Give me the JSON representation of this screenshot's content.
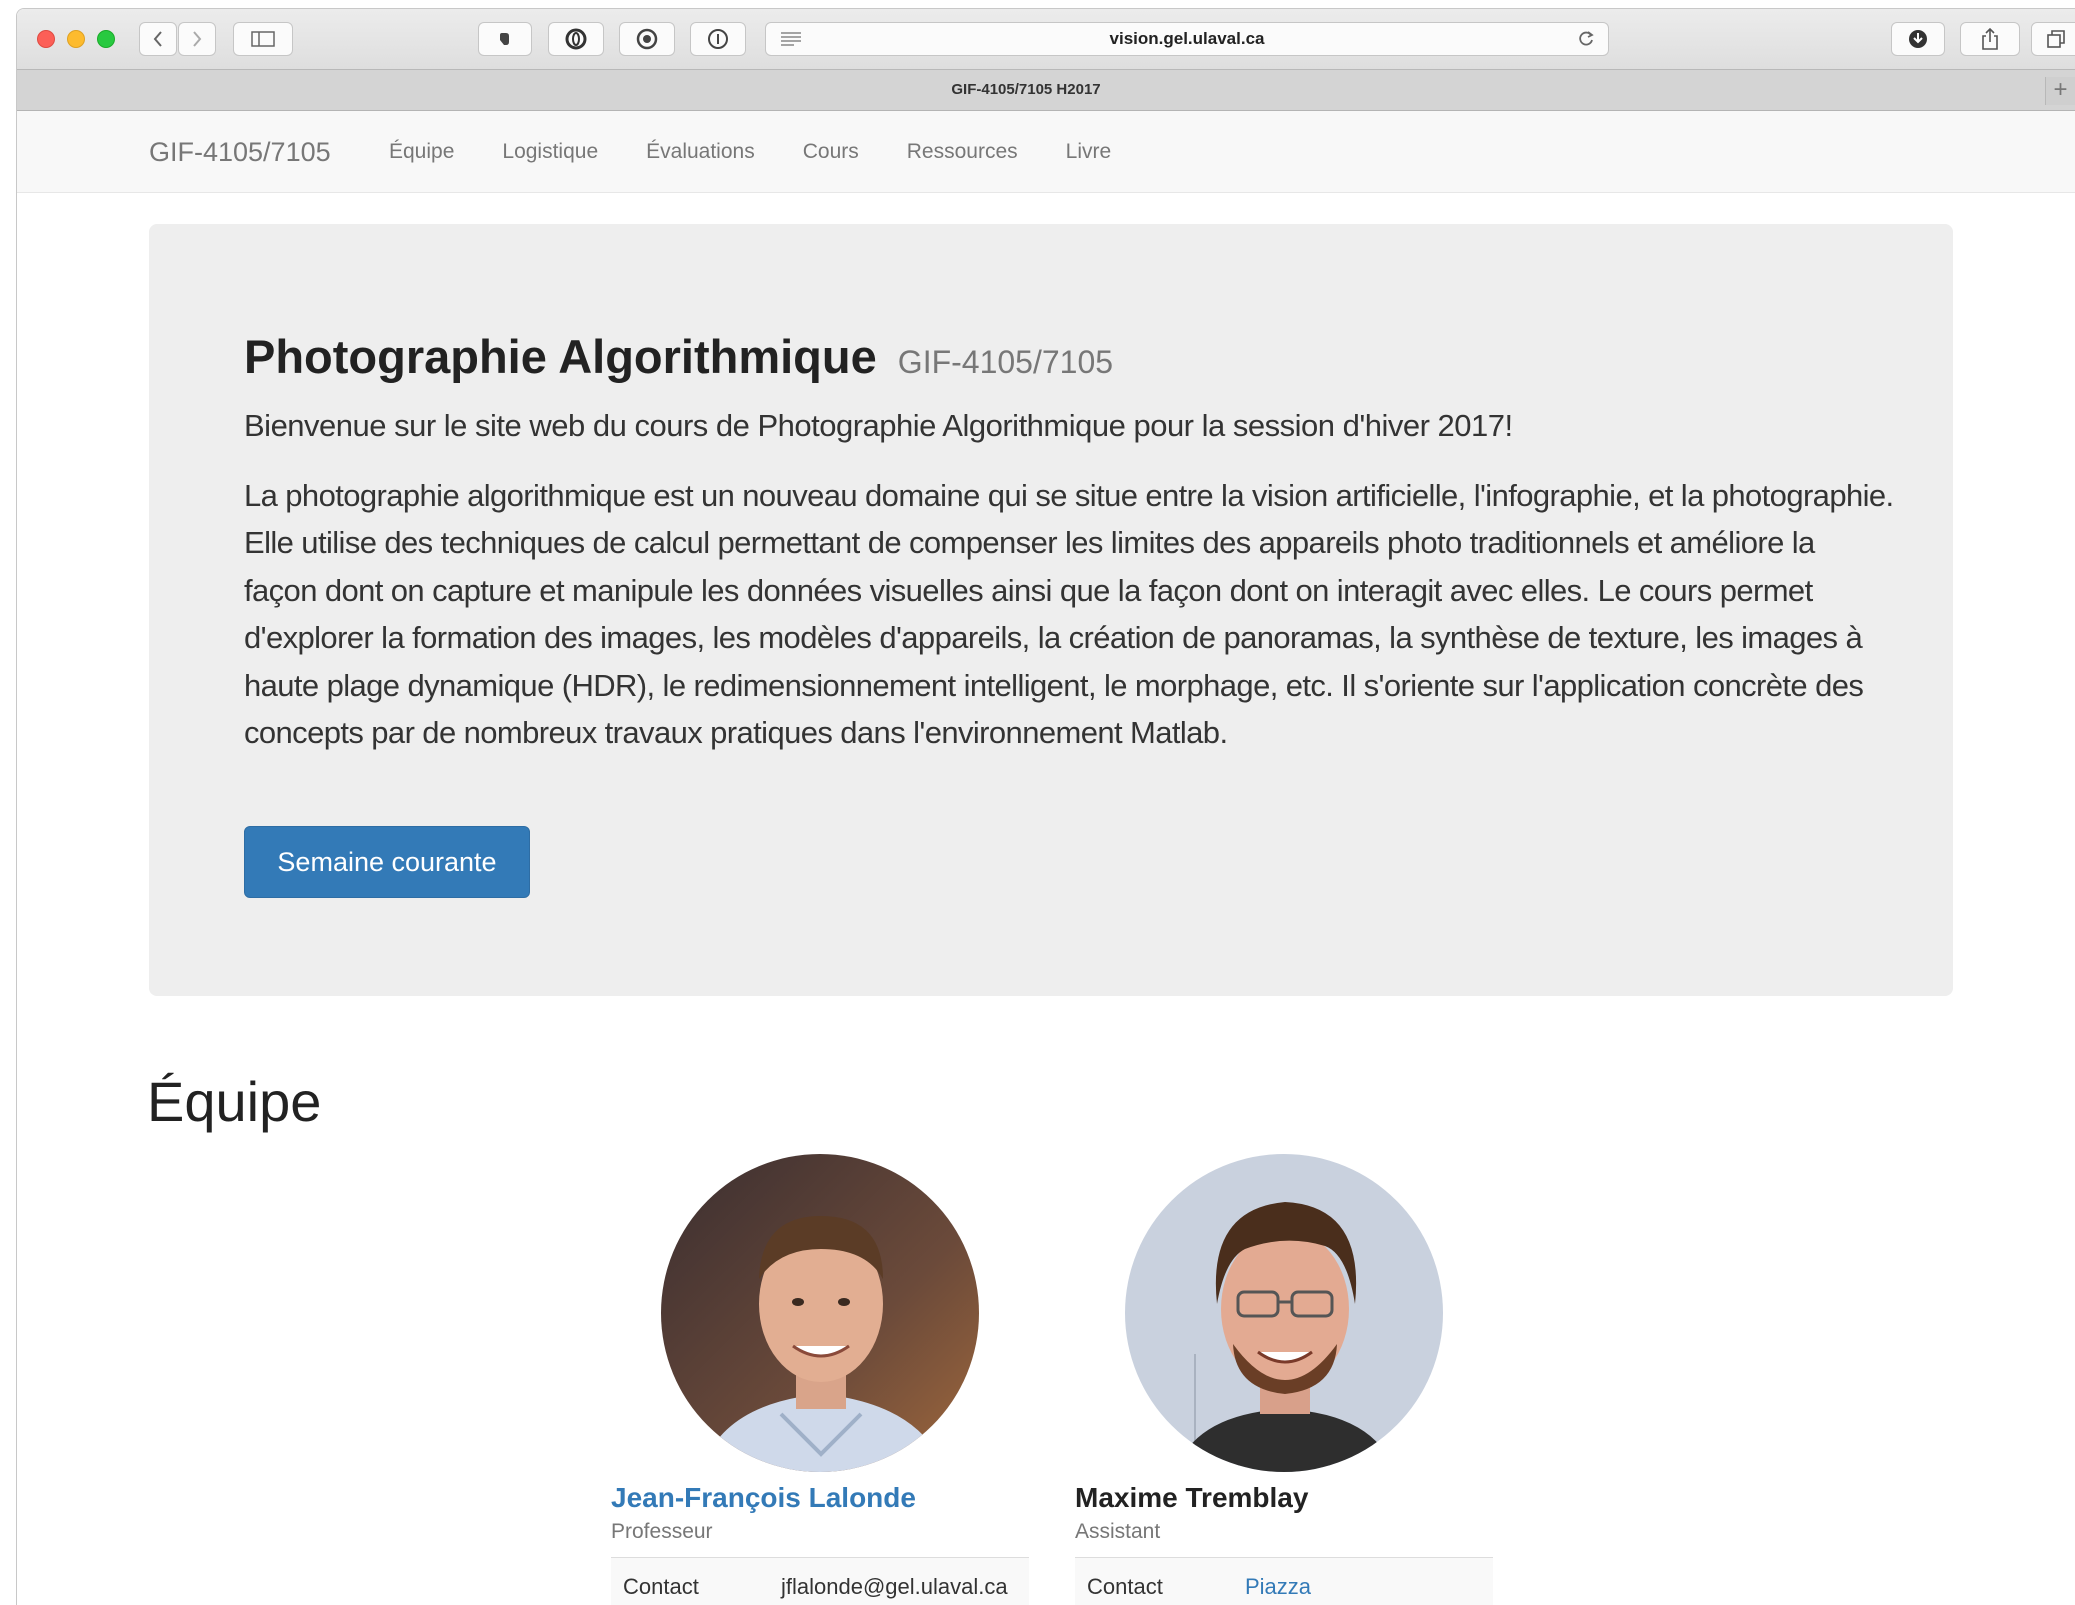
{
  "browser": {
    "url": "vision.gel.ulaval.ca",
    "tab_title": "GIF-4105/7105 H2017",
    "new_tab_glyph": "+",
    "icons": [
      "back-icon",
      "forward-icon",
      "sidebar-icon",
      "hand-icon",
      "extension-icon",
      "adblock-icon",
      "info-icon",
      "reader-icon",
      "reload-icon",
      "download-icon",
      "share-icon",
      "tabs-icon"
    ]
  },
  "nav": {
    "brand": "GIF-4105/7105",
    "links": [
      "Équipe",
      "Logistique",
      "Évaluations",
      "Cours",
      "Ressources",
      "Livre"
    ]
  },
  "jumbotron": {
    "title": "Photographie Algorithmique",
    "subtitle": "GIF-4105/7105",
    "lead": "Bienvenue sur le site web du cours de Photographie Algorithmique pour la session d'hiver 2017!",
    "description": "La photographie algorithmique est un nouveau domaine qui se situe entre la vision artificielle, l'infographie, et la photographie. Elle utilise des techniques de calcul permettant de compenser les limites des appareils photo traditionnels et améliore la façon dont on capture et manipule les données visuelles ainsi que la façon dont on interagit avec elles. Le cours permet d'explorer la formation des images, les modèles d'appareils, la création de panoramas, la synthèse de texture, les images à haute plage dynamique (HDR), le redimensionnement intelligent, le morphage, etc. Il s'oriente sur l'application concrète des concepts par de nombreux travaux pratiques dans l'environnement Matlab.",
    "button": "Semaine courante"
  },
  "team": {
    "heading": "Équipe",
    "members": [
      {
        "name": "Jean-François Lalonde",
        "role": "Professeur",
        "contact_label": "Contact",
        "contact_value": "jflalonde@gel.ulaval.ca"
      },
      {
        "name": "Maxime Tremblay",
        "role": "Assistant",
        "contact_label": "Contact",
        "contact_value": "Piazza"
      }
    ]
  },
  "colors": {
    "primary": "#337ab7",
    "jumbotron_bg": "#eeeeee",
    "navbar_bg": "#f8f8f8"
  }
}
